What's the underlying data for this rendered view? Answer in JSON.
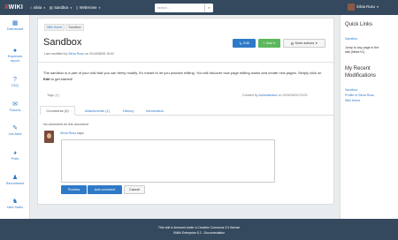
{
  "topbar": {
    "logo_mark": "X",
    "logo_text": "WIKI",
    "crumbs": [
      {
        "icon": "home-icon",
        "label": "silvia"
      },
      {
        "icon": "folder-icon",
        "label": "Sandbox"
      },
      {
        "icon": "file-icon",
        "label": "WebHome"
      }
    ],
    "search_placeholder": "search...",
    "user_name": "Silvia Rusu"
  },
  "leftnav": {
    "items": [
      {
        "icon": "dashboard-icon",
        "label": "Dashboard"
      },
      {
        "icon": "expenses-icon",
        "label": "Expenses report"
      },
      {
        "icon": "faq-icon",
        "label": "FAQ"
      },
      {
        "icon": "forums-icon",
        "label": "Forums"
      },
      {
        "icon": "job-area-icon",
        "label": "Job Area"
      },
      {
        "icon": "polls-icon",
        "label": "Polls"
      },
      {
        "icon": "recruitment-icon",
        "label": "Recruitment"
      },
      {
        "icon": "user-index-icon",
        "label": "User Index"
      }
    ]
  },
  "main": {
    "breadcrumbs": [
      "Wiki Home",
      "Sandbox"
    ],
    "title": "Sandbox",
    "last_modified_prefix": "Last modified by ",
    "last_modified_user": "Silvia Rusu",
    "last_modified_suffix": " on 2014/08/05 15:02",
    "buttons": {
      "edit": "Edit",
      "add": "Add",
      "more": "More actions"
    },
    "content_before": "The sandbox is a part of your wiki that you can freely modify. It's meant to let you practice editing. You will discover how page editing works and create new pages. Simply click on ",
    "content_bold": "Edit",
    "content_after": " to get started!",
    "tags": "Tags: [+]",
    "created_by_prefix": "Created by ",
    "created_by_user": "Administrator",
    "created_by_suffix": " on 2009/09/09 03:00",
    "tabs": [
      "Comments (0)",
      "Attachments (1)",
      "History",
      "Information"
    ],
    "no_comments": "No comments for this document",
    "commenter": "Silvia Rusu",
    "says": " says:",
    "comment_buttons": {
      "preview": "Preview",
      "add": "Add comment",
      "cancel": "Cancel"
    }
  },
  "rightpanel": {
    "quick_links_title": "Quick Links",
    "quick_links": [
      "Sandbox"
    ],
    "jump_text_1": "Jump to any page in the",
    "jump_text_2": "wiki (Meta+G)",
    "recent_title_1": "My Recent",
    "recent_title_2": "Modifications",
    "recent": [
      "Sandbox",
      "Profile of Silvia Rusu",
      "Wiki Home"
    ]
  },
  "footer": {
    "license": "This wiki is licensed under a Creative Commons 2.0 license",
    "version": "XWiki Enterprise 6.2 - Documentation"
  },
  "colors": {
    "topbar": "#34495e",
    "accent": "#2f7ac7",
    "add_green": "#5cb85c",
    "logo_red": "#e74c3c"
  }
}
